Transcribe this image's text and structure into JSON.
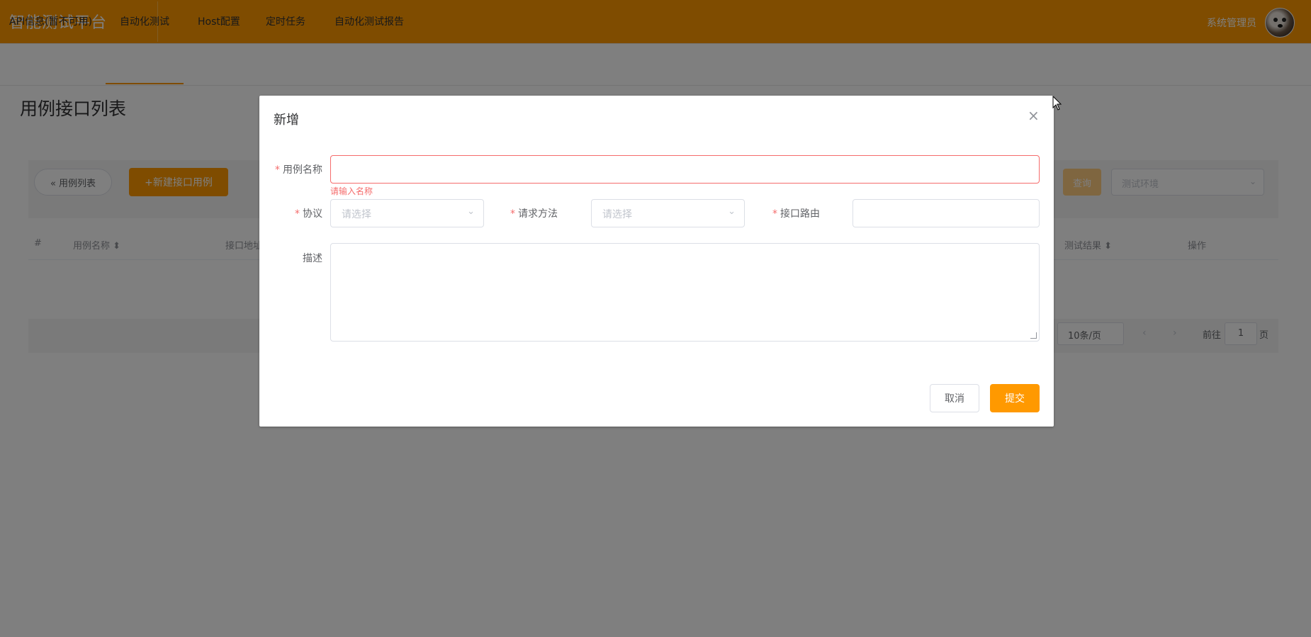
{
  "header": {
    "brand": "智能测试平台",
    "user": "系统管理员",
    "brand_color": "#FF9900"
  },
  "nav": {
    "items": [
      "API信息(暂不可用)",
      "自动化测试",
      "Host配置",
      "定时任务",
      "自动化测试报告"
    ],
    "active_index": 1
  },
  "page": {
    "title": "用例接口列表",
    "back_button": "« 用例列表",
    "new_button": "+新建接口用例",
    "query_button": "查询",
    "env_select_placeholder": "测试环境"
  },
  "table": {
    "headers": [
      "#",
      "用例名称",
      "接口地址",
      "测试结果",
      "操作"
    ]
  },
  "pager": {
    "page_size": "10条/页",
    "goto_label": "前往",
    "current_page": "1",
    "page_suffix": "页"
  },
  "dialog": {
    "title": "新增",
    "fields": {
      "name": {
        "label": "用例名称",
        "value": "",
        "error": "请输入名称"
      },
      "protocol": {
        "label": "协议",
        "placeholder": "请选择"
      },
      "method": {
        "label": "请求方法",
        "placeholder": "请选择"
      },
      "route": {
        "label": "接口路由",
        "value": ""
      },
      "description": {
        "label": "描述",
        "value": ""
      }
    },
    "cancel_button": "取消",
    "submit_button": "提交"
  },
  "colors": {
    "accent": "#FF9900",
    "error": "#F56C6C"
  }
}
